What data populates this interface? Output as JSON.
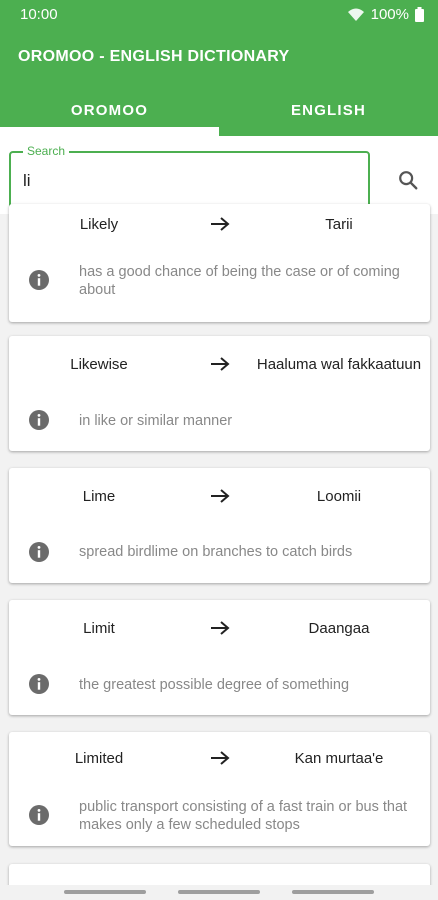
{
  "status": {
    "time": "10:00",
    "battery": "100%"
  },
  "app": {
    "title": "OROMOO - ENGLISH DICTIONARY"
  },
  "tabs": [
    {
      "label": "OROMOO"
    },
    {
      "label": "ENGLISH"
    }
  ],
  "search": {
    "label": "Search",
    "value": "li"
  },
  "entries": [
    {
      "word": "Likely",
      "translation": "Tarii",
      "definition": "has a good chance of being the case or of coming about"
    },
    {
      "word": "Likewise",
      "translation": "Haaluma wal fakkaatuun",
      "definition": "in like or similar manner"
    },
    {
      "word": "Lime",
      "translation": "Loomii",
      "definition": "spread birdlime on branches to catch birds"
    },
    {
      "word": "Limit",
      "translation": "Daangaa",
      "definition": "the greatest possible degree of something"
    },
    {
      "word": "Limited",
      "translation": "Kan murtaa'e",
      "definition": "public transport consisting of a fast train or bus that makes only a few scheduled stops"
    }
  ],
  "colors": {
    "primary": "#4caf50",
    "background": "#f2f2f2"
  },
  "icons": {
    "info": "info-icon",
    "arrow": "arrow-right-icon",
    "search": "search-icon"
  }
}
